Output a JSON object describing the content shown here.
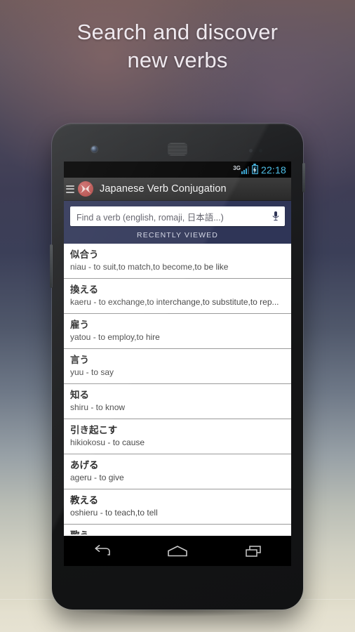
{
  "headline": {
    "line1": "Search and discover",
    "line2": "new verbs"
  },
  "statusbar": {
    "network": "3G",
    "clock": "22:18",
    "battery_icon": "battery-charging-icon",
    "signal_icon": "signal-bars-icon"
  },
  "actionbar": {
    "menu_icon": "hamburger-menu-icon",
    "logo_icon": "app-logo-icon",
    "title": "Japanese Verb Conjugation"
  },
  "search": {
    "placeholder": "Find a verb (english, romaji, 日本語...)",
    "value": "",
    "mic_icon": "microphone-icon",
    "section_header": "RECENTLY VIEWED"
  },
  "verbs": [
    {
      "kanji": "似合う",
      "romaji": "niau - to suit,to match,to become,to be like"
    },
    {
      "kanji": "換える",
      "romaji": "kaeru - to exchange,to interchange,to substitute,to rep..."
    },
    {
      "kanji": "雇う",
      "romaji": "yatou - to employ,to hire"
    },
    {
      "kanji": "言う",
      "romaji": "yuu - to say"
    },
    {
      "kanji": "知る",
      "romaji": "shiru - to know"
    },
    {
      "kanji": "引き起こす",
      "romaji": "hikiokosu - to cause"
    },
    {
      "kanji": "あげる",
      "romaji": "ageru - to give"
    },
    {
      "kanji": "教える",
      "romaji": "oshieru - to teach,to tell"
    },
    {
      "kanji": "歌う",
      "romaji": ""
    }
  ],
  "navbar": {
    "back": "back-icon",
    "home": "home-icon",
    "recents": "recents-icon"
  },
  "colors": {
    "accent_navy": "#2f3557",
    "logo_red": "#b9524f",
    "clock_blue": "#4fc0e8",
    "actionbar_grey": "#323232"
  }
}
